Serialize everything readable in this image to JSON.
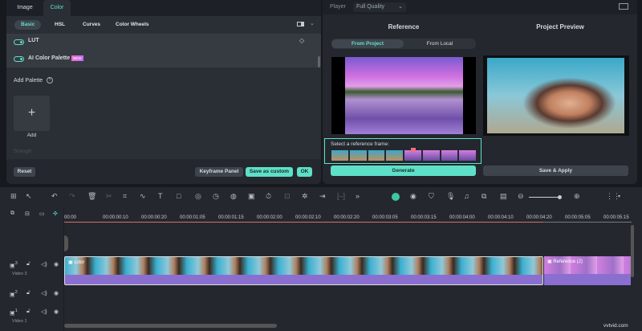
{
  "left_panel": {
    "tabs": [
      "Image",
      "Color"
    ],
    "active_tab": "Color",
    "subtabs": [
      "Basic",
      "HSL",
      "Curves",
      "Color Wheels"
    ],
    "active_subtab": "Basic",
    "lut_label": "LUT",
    "ai_label": "AI Color Palette",
    "new_badge": "NEW",
    "add_palette": "Add Palette",
    "add_label": "Add",
    "strength": "Strength",
    "reset": "Reset",
    "keyframe": "Keyframe Panel",
    "save_custom": "Save as custom",
    "ok": "OK"
  },
  "player": {
    "label": "Player",
    "quality": "Full Quality",
    "reference_title": "Reference",
    "preview_title": "Project Preview",
    "from_project": "From Project",
    "from_local": "From Local",
    "select_frame": "Select a reference frame:",
    "generate": "Generate",
    "save_apply": "Save & Apply"
  },
  "timeline": {
    "ruler": [
      "00:00",
      "00:00:00:10",
      "00:00:00:20",
      "00:00:01:05",
      "00:00:01:15",
      "00:00:02:00",
      "00:00:02:10",
      "00:00:02:20",
      "00:00:03:05",
      "00:00:03:15",
      "00:00:04:00",
      "00:00:04:10",
      "00:00:04:20",
      "00:00:05:05",
      "00:00:05:15"
    ],
    "tracks": [
      {
        "num": "3",
        "name": "Video 3"
      },
      {
        "num": "2",
        "name": ""
      },
      {
        "num": "1",
        "name": "Video 1"
      }
    ],
    "clip1": "color",
    "clip2": "Reference (2)"
  },
  "watermark": "vvtvid.com",
  "colors": {
    "accent": "#5ee0c8",
    "clip": "#8a6fd0"
  }
}
